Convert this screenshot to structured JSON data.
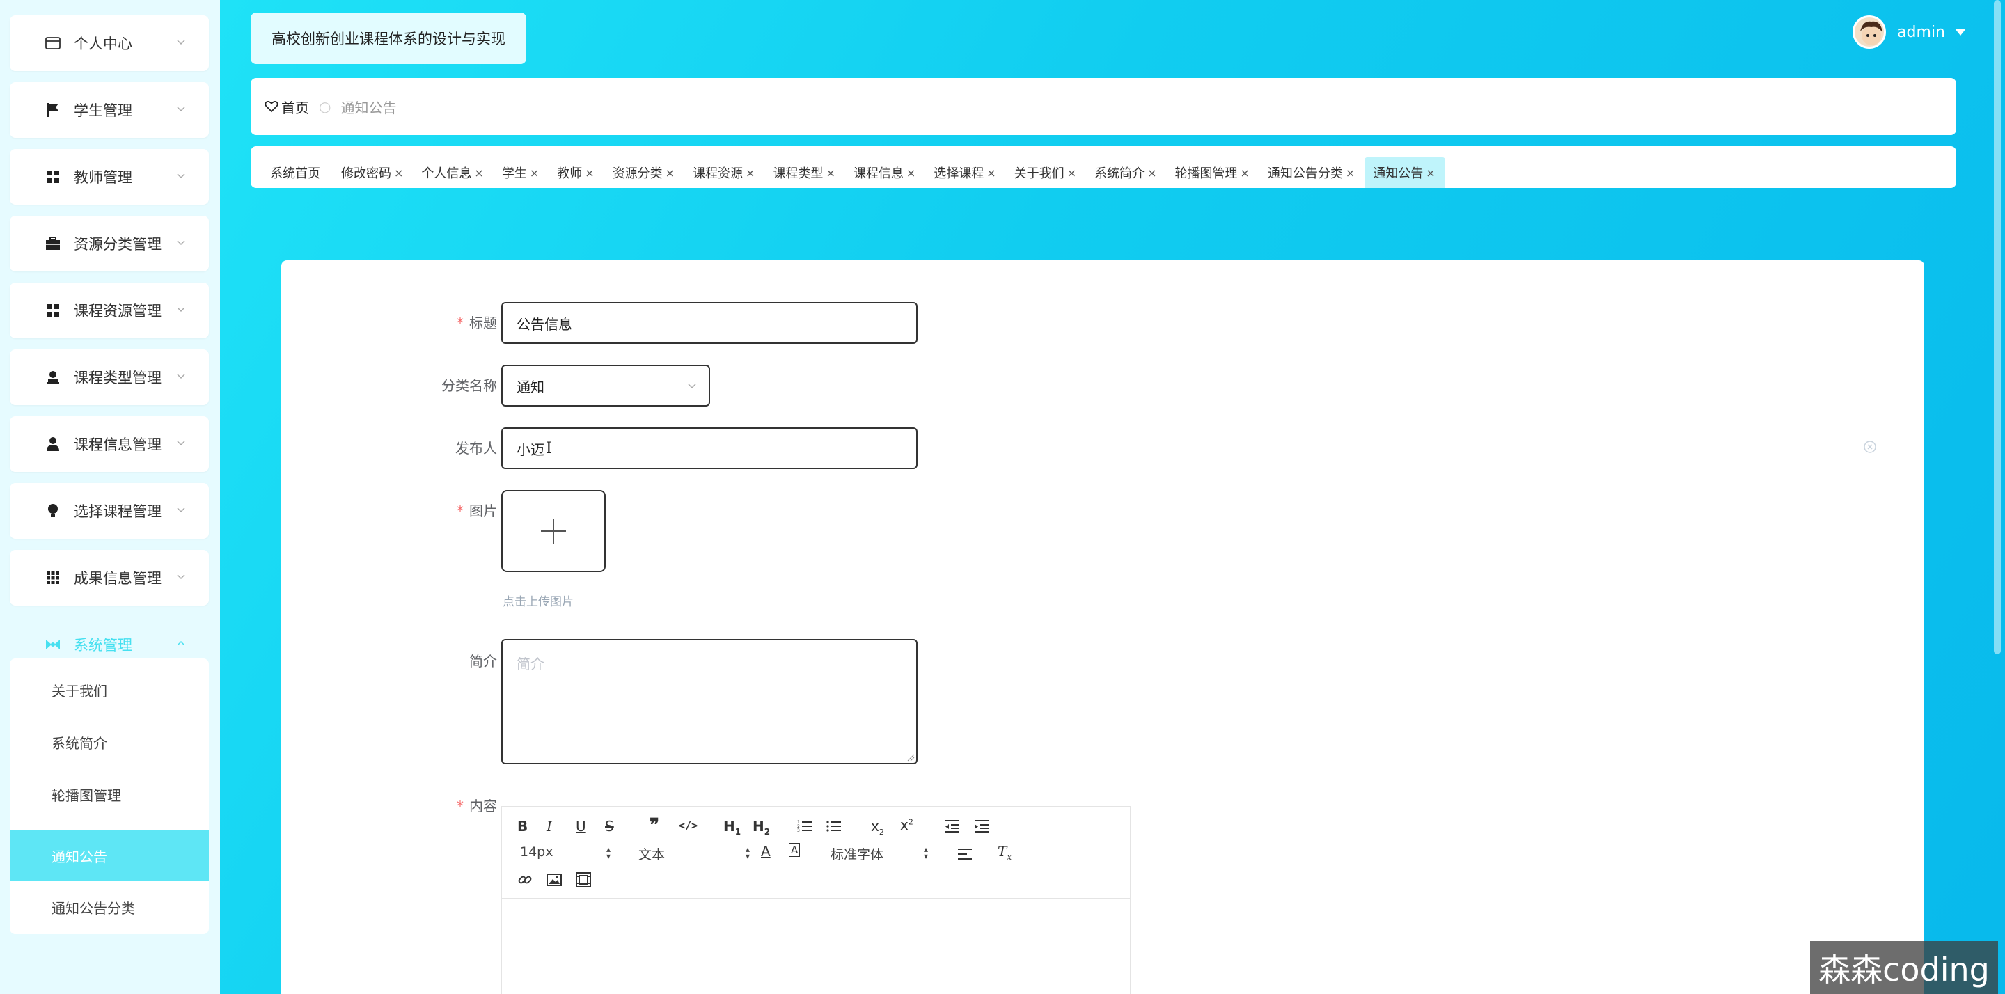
{
  "app_title": "高校创新创业课程体系的设计与实现",
  "user": {
    "name": "admin"
  },
  "breadcrumb": {
    "home": "首页",
    "current": "通知公告"
  },
  "sidebar": {
    "items": [
      {
        "label": "个人中心",
        "icon": "credit-card-icon"
      },
      {
        "label": "学生管理",
        "icon": "flag-icon"
      },
      {
        "label": "教师管理",
        "icon": "grid-icon"
      },
      {
        "label": "资源分类管理",
        "icon": "briefcase-icon"
      },
      {
        "label": "课程资源管理",
        "icon": "grid-icon"
      },
      {
        "label": "课程类型管理",
        "icon": "user-stamp-icon"
      },
      {
        "label": "课程信息管理",
        "icon": "person-icon"
      },
      {
        "label": "选择课程管理",
        "icon": "bulb-icon"
      },
      {
        "label": "成果信息管理",
        "icon": "apps-icon"
      },
      {
        "label": "系统管理",
        "icon": "bow-icon"
      }
    ],
    "sub_items": [
      {
        "label": "关于我们"
      },
      {
        "label": "系统简介"
      },
      {
        "label": "轮播图管理"
      },
      {
        "label": "通知公告"
      },
      {
        "label": "通知公告分类"
      }
    ]
  },
  "tabs": [
    {
      "label": "系统首页",
      "close": ""
    },
    {
      "label": "修改密码",
      "close": "×"
    },
    {
      "label": "个人信息",
      "close": "×"
    },
    {
      "label": "学生",
      "close": "×"
    },
    {
      "label": "教师",
      "close": "×"
    },
    {
      "label": "资源分类",
      "close": "×"
    },
    {
      "label": "课程资源",
      "close": "×"
    },
    {
      "label": "课程类型",
      "close": "×"
    },
    {
      "label": "课程信息",
      "close": "×"
    },
    {
      "label": "选择课程",
      "close": "×"
    },
    {
      "label": "关于我们",
      "close": "×"
    },
    {
      "label": "系统简介",
      "close": "×"
    },
    {
      "label": "轮播图管理",
      "close": "×"
    },
    {
      "label": "通知公告分类",
      "close": "×"
    },
    {
      "label": "通知公告",
      "close": "×"
    }
  ],
  "form": {
    "title": {
      "label": "标题",
      "required": "*",
      "value": "公告信息"
    },
    "category": {
      "label": "分类名称",
      "value": "通知"
    },
    "publisher": {
      "label": "发布人",
      "value": "小迈"
    },
    "image": {
      "label": "图片",
      "required": "*",
      "hint": "点击上传图片"
    },
    "summary": {
      "label": "简介",
      "placeholder": "简介"
    },
    "content": {
      "label": "内容",
      "required": "*",
      "toolbar": {
        "font_size": "14px",
        "header": "文本",
        "font": "标准字体"
      }
    }
  },
  "watermark": "森森coding",
  "colors": {
    "accent": "#5ee6f5",
    "gradient_start": "#1fe2f7",
    "gradient_end": "#08b9ec",
    "required": "#f56c6c"
  }
}
